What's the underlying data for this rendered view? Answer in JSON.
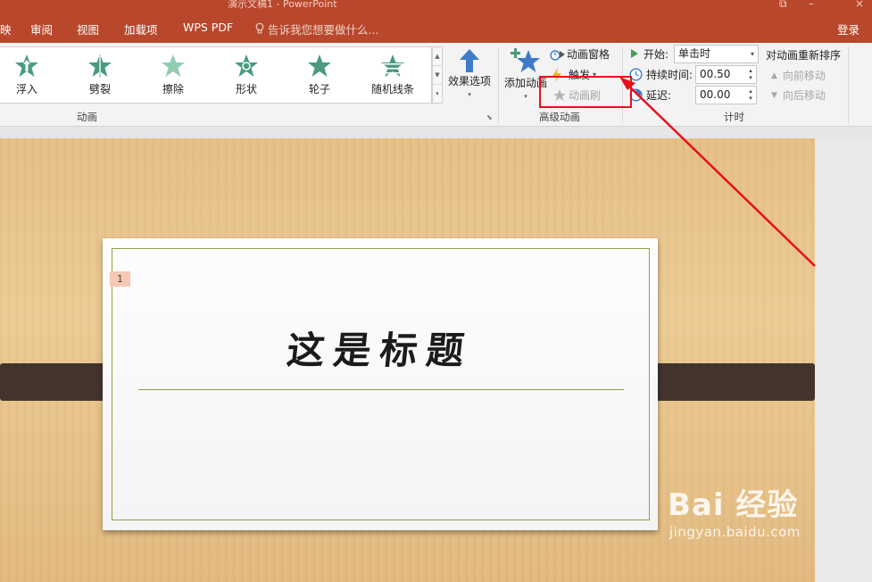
{
  "titlebar": {
    "title": "演示文稿1 - PowerPoint"
  },
  "tabs": [
    {
      "label": "映"
    },
    {
      "label": "审阅"
    },
    {
      "label": "视图"
    },
    {
      "label": "加载项"
    },
    {
      "label": "WPS PDF"
    }
  ],
  "tell_me": "告诉我您想要做什么...",
  "login": "登录",
  "animation_gallery": {
    "items": [
      {
        "label": "浮入",
        "color": "#4a9a7e"
      },
      {
        "label": "劈裂",
        "color": "#4a9a7e"
      },
      {
        "label": "擦除",
        "color": "#7fc3a5"
      },
      {
        "label": "形状",
        "color": "#4a9a7e"
      },
      {
        "label": "轮子",
        "color": "#4a9a7e"
      },
      {
        "label": "随机线条",
        "color": "#4a9a7e"
      }
    ],
    "group_label": "动画"
  },
  "effect_options": {
    "label": "效果选项"
  },
  "advanced": {
    "add_animation": "添加动画",
    "animation_pane": "动画窗格",
    "trigger": "触发",
    "animation_painter": "动画刷",
    "group_label": "高级动画"
  },
  "timing": {
    "start_label": "开始:",
    "start_value": "单击时",
    "duration_label": "持续时间:",
    "duration_value": "00.50",
    "delay_label": "延迟:",
    "delay_value": "00.00",
    "reorder_title": "对动画重新排序",
    "move_earlier": "向前移动",
    "move_later": "向后移动",
    "group_label": "计时"
  },
  "slide": {
    "animation_tag": "1",
    "title": "这是标题"
  },
  "watermark": {
    "brand": "Bai 经验",
    "url": "jingyan.baidu.com"
  },
  "colors": {
    "accent": "#b8472b",
    "highlight": "#e8101b"
  }
}
